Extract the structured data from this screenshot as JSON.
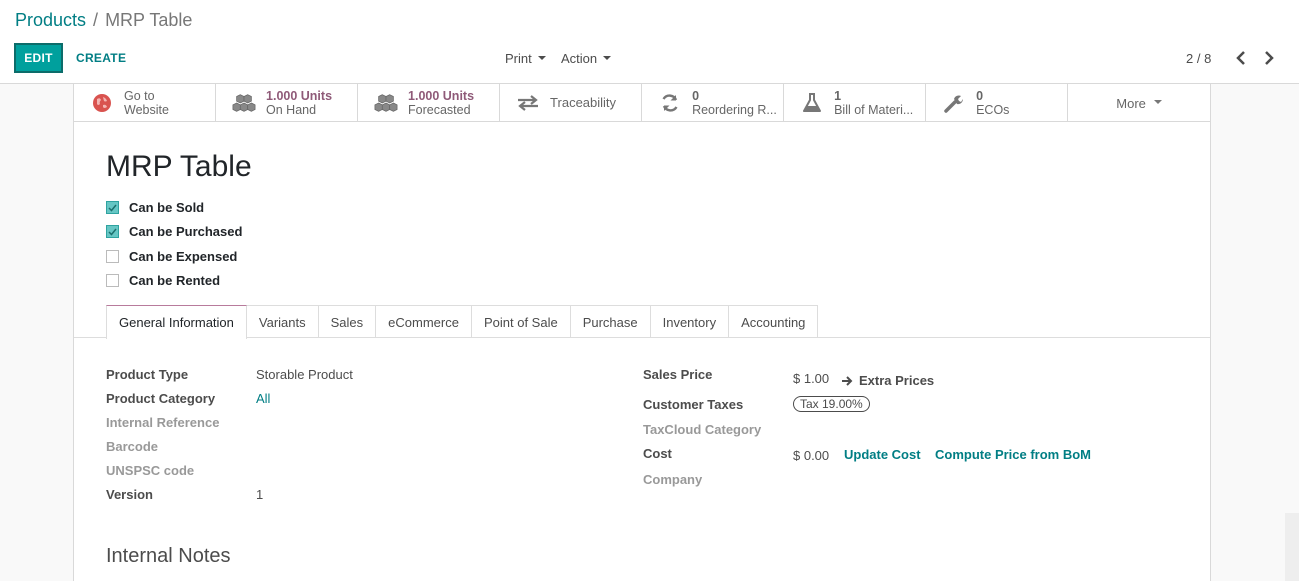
{
  "breadcrumb": {
    "parent": "Products",
    "separator": "/",
    "current": "MRP Table"
  },
  "toolbar": {
    "edit_label": "EDIT",
    "create_label": "CREATE",
    "print_label": "Print",
    "action_label": "Action"
  },
  "pager": {
    "value": "2 / 8"
  },
  "smart_buttons": [
    {
      "icon": "globe-icon",
      "line1": "Go to",
      "line2": "Website"
    },
    {
      "icon": "cubes-icon",
      "line1": "1.000 Units",
      "line2": "On Hand"
    },
    {
      "icon": "cubes-icon",
      "line1": "1.000 Units",
      "line2": "Forecasted"
    },
    {
      "icon": "exchange-icon",
      "single": "Traceability"
    },
    {
      "icon": "refresh-icon",
      "line1": "0",
      "line2": "Reordering R..."
    },
    {
      "icon": "flask-icon",
      "line1": "1",
      "line2": "Bill of Materi..."
    },
    {
      "icon": "wrench-icon",
      "line1": "0",
      "line2": "ECOs"
    },
    {
      "icon": "more",
      "single": "More"
    }
  ],
  "product": {
    "name": "MRP Table",
    "flags": [
      {
        "label": "Can be Sold",
        "checked": true
      },
      {
        "label": "Can be Purchased",
        "checked": true
      },
      {
        "label": "Can be Expensed",
        "checked": false
      },
      {
        "label": "Can be Rented",
        "checked": false
      }
    ]
  },
  "tabs": [
    "General Information",
    "Variants",
    "Sales",
    "eCommerce",
    "Point of Sale",
    "Purchase",
    "Inventory",
    "Accounting"
  ],
  "general": {
    "product_type_label": "Product Type",
    "product_type": "Storable Product",
    "category_label": "Product Category",
    "category": "All",
    "internal_ref_label": "Internal Reference",
    "barcode_label": "Barcode",
    "unspsc_label": "UNSPSC code",
    "version_label": "Version",
    "version": "1",
    "sales_price_label": "Sales Price",
    "sales_price": "$ 1.00",
    "extra_prices": "Extra Prices",
    "customer_taxes_label": "Customer Taxes",
    "tax_badge": "Tax 19.00%",
    "taxcloud_label": "TaxCloud Category",
    "cost_label": "Cost",
    "cost": "$ 0.00",
    "update_cost": "Update Cost",
    "compute_price": "Compute Price from BoM",
    "company_label": "Company"
  },
  "notes_title": "Internal Notes",
  "colors": {
    "primary": "#00a09d",
    "link": "#017e84",
    "stat_value": "#8f5a78"
  }
}
